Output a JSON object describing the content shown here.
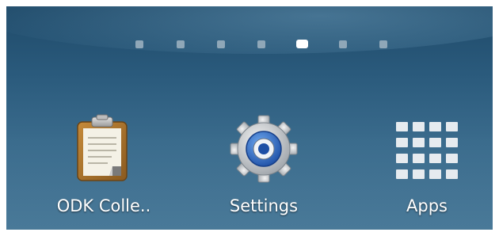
{
  "home_screen": {
    "page_indicator": {
      "page_count": 7,
      "active_page": 5
    },
    "apps": [
      {
        "label": "ODK Colle..",
        "icon": "clipboard-icon"
      },
      {
        "label": "Settings",
        "icon": "gear-icon"
      },
      {
        "label": "Apps",
        "icon": "app-grid-icon"
      }
    ]
  },
  "colors": {
    "wallpaper_top": "#1f4a69",
    "wallpaper_bottom": "#406f8f",
    "dot_inactive": "#8fa7b8",
    "dot_active": "#ffffff",
    "label_text": "#ffffff"
  }
}
